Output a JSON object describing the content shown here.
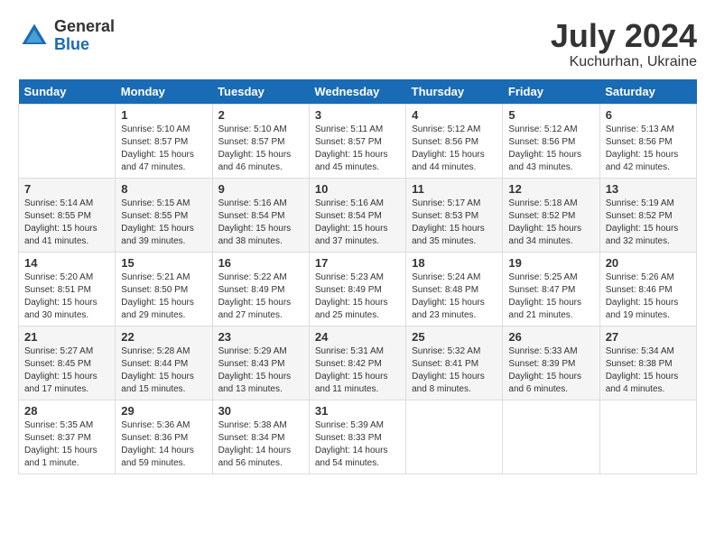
{
  "logo": {
    "general": "General",
    "blue": "Blue"
  },
  "title": {
    "month": "July 2024",
    "location": "Kuchurhan, Ukraine"
  },
  "days_of_week": [
    "Sunday",
    "Monday",
    "Tuesday",
    "Wednesday",
    "Thursday",
    "Friday",
    "Saturday"
  ],
  "weeks": [
    [
      {
        "day": "",
        "sunrise": "",
        "sunset": "",
        "daylight": ""
      },
      {
        "day": "1",
        "sunrise": "Sunrise: 5:10 AM",
        "sunset": "Sunset: 8:57 PM",
        "daylight": "Daylight: 15 hours and 47 minutes."
      },
      {
        "day": "2",
        "sunrise": "Sunrise: 5:10 AM",
        "sunset": "Sunset: 8:57 PM",
        "daylight": "Daylight: 15 hours and 46 minutes."
      },
      {
        "day": "3",
        "sunrise": "Sunrise: 5:11 AM",
        "sunset": "Sunset: 8:57 PM",
        "daylight": "Daylight: 15 hours and 45 minutes."
      },
      {
        "day": "4",
        "sunrise": "Sunrise: 5:12 AM",
        "sunset": "Sunset: 8:56 PM",
        "daylight": "Daylight: 15 hours and 44 minutes."
      },
      {
        "day": "5",
        "sunrise": "Sunrise: 5:12 AM",
        "sunset": "Sunset: 8:56 PM",
        "daylight": "Daylight: 15 hours and 43 minutes."
      },
      {
        "day": "6",
        "sunrise": "Sunrise: 5:13 AM",
        "sunset": "Sunset: 8:56 PM",
        "daylight": "Daylight: 15 hours and 42 minutes."
      }
    ],
    [
      {
        "day": "7",
        "sunrise": "Sunrise: 5:14 AM",
        "sunset": "Sunset: 8:55 PM",
        "daylight": "Daylight: 15 hours and 41 minutes."
      },
      {
        "day": "8",
        "sunrise": "Sunrise: 5:15 AM",
        "sunset": "Sunset: 8:55 PM",
        "daylight": "Daylight: 15 hours and 39 minutes."
      },
      {
        "day": "9",
        "sunrise": "Sunrise: 5:16 AM",
        "sunset": "Sunset: 8:54 PM",
        "daylight": "Daylight: 15 hours and 38 minutes."
      },
      {
        "day": "10",
        "sunrise": "Sunrise: 5:16 AM",
        "sunset": "Sunset: 8:54 PM",
        "daylight": "Daylight: 15 hours and 37 minutes."
      },
      {
        "day": "11",
        "sunrise": "Sunrise: 5:17 AM",
        "sunset": "Sunset: 8:53 PM",
        "daylight": "Daylight: 15 hours and 35 minutes."
      },
      {
        "day": "12",
        "sunrise": "Sunrise: 5:18 AM",
        "sunset": "Sunset: 8:52 PM",
        "daylight": "Daylight: 15 hours and 34 minutes."
      },
      {
        "day": "13",
        "sunrise": "Sunrise: 5:19 AM",
        "sunset": "Sunset: 8:52 PM",
        "daylight": "Daylight: 15 hours and 32 minutes."
      }
    ],
    [
      {
        "day": "14",
        "sunrise": "Sunrise: 5:20 AM",
        "sunset": "Sunset: 8:51 PM",
        "daylight": "Daylight: 15 hours and 30 minutes."
      },
      {
        "day": "15",
        "sunrise": "Sunrise: 5:21 AM",
        "sunset": "Sunset: 8:50 PM",
        "daylight": "Daylight: 15 hours and 29 minutes."
      },
      {
        "day": "16",
        "sunrise": "Sunrise: 5:22 AM",
        "sunset": "Sunset: 8:49 PM",
        "daylight": "Daylight: 15 hours and 27 minutes."
      },
      {
        "day": "17",
        "sunrise": "Sunrise: 5:23 AM",
        "sunset": "Sunset: 8:49 PM",
        "daylight": "Daylight: 15 hours and 25 minutes."
      },
      {
        "day": "18",
        "sunrise": "Sunrise: 5:24 AM",
        "sunset": "Sunset: 8:48 PM",
        "daylight": "Daylight: 15 hours and 23 minutes."
      },
      {
        "day": "19",
        "sunrise": "Sunrise: 5:25 AM",
        "sunset": "Sunset: 8:47 PM",
        "daylight": "Daylight: 15 hours and 21 minutes."
      },
      {
        "day": "20",
        "sunrise": "Sunrise: 5:26 AM",
        "sunset": "Sunset: 8:46 PM",
        "daylight": "Daylight: 15 hours and 19 minutes."
      }
    ],
    [
      {
        "day": "21",
        "sunrise": "Sunrise: 5:27 AM",
        "sunset": "Sunset: 8:45 PM",
        "daylight": "Daylight: 15 hours and 17 minutes."
      },
      {
        "day": "22",
        "sunrise": "Sunrise: 5:28 AM",
        "sunset": "Sunset: 8:44 PM",
        "daylight": "Daylight: 15 hours and 15 minutes."
      },
      {
        "day": "23",
        "sunrise": "Sunrise: 5:29 AM",
        "sunset": "Sunset: 8:43 PM",
        "daylight": "Daylight: 15 hours and 13 minutes."
      },
      {
        "day": "24",
        "sunrise": "Sunrise: 5:31 AM",
        "sunset": "Sunset: 8:42 PM",
        "daylight": "Daylight: 15 hours and 11 minutes."
      },
      {
        "day": "25",
        "sunrise": "Sunrise: 5:32 AM",
        "sunset": "Sunset: 8:41 PM",
        "daylight": "Daylight: 15 hours and 8 minutes."
      },
      {
        "day": "26",
        "sunrise": "Sunrise: 5:33 AM",
        "sunset": "Sunset: 8:39 PM",
        "daylight": "Daylight: 15 hours and 6 minutes."
      },
      {
        "day": "27",
        "sunrise": "Sunrise: 5:34 AM",
        "sunset": "Sunset: 8:38 PM",
        "daylight": "Daylight: 15 hours and 4 minutes."
      }
    ],
    [
      {
        "day": "28",
        "sunrise": "Sunrise: 5:35 AM",
        "sunset": "Sunset: 8:37 PM",
        "daylight": "Daylight: 15 hours and 1 minute."
      },
      {
        "day": "29",
        "sunrise": "Sunrise: 5:36 AM",
        "sunset": "Sunset: 8:36 PM",
        "daylight": "Daylight: 14 hours and 59 minutes."
      },
      {
        "day": "30",
        "sunrise": "Sunrise: 5:38 AM",
        "sunset": "Sunset: 8:34 PM",
        "daylight": "Daylight: 14 hours and 56 minutes."
      },
      {
        "day": "31",
        "sunrise": "Sunrise: 5:39 AM",
        "sunset": "Sunset: 8:33 PM",
        "daylight": "Daylight: 14 hours and 54 minutes."
      },
      {
        "day": "",
        "sunrise": "",
        "sunset": "",
        "daylight": ""
      },
      {
        "day": "",
        "sunrise": "",
        "sunset": "",
        "daylight": ""
      },
      {
        "day": "",
        "sunrise": "",
        "sunset": "",
        "daylight": ""
      }
    ]
  ]
}
